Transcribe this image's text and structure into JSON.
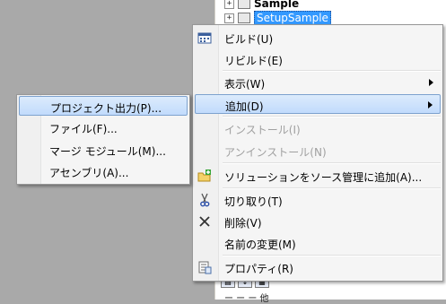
{
  "explorer": {
    "project_name": "Sample",
    "selected_project": "SetupSample",
    "bottom_label": "ー ー ー 他"
  },
  "context_menu": {
    "items": [
      {
        "label": "ビルド(U)",
        "icon": "build-icon"
      },
      {
        "label": "リビルド(E)"
      },
      {
        "label": "表示(W)"
      },
      {
        "label": "追加(D)"
      },
      {
        "label": "インストール(I)"
      },
      {
        "label": "アンインストール(N)"
      },
      {
        "label": "ソリューションをソース管理に追加(A)...",
        "icon": "add-to-source-control-icon"
      },
      {
        "label": "切り取り(T)",
        "icon": "scissors-icon"
      },
      {
        "label": "削除(V)",
        "icon": "delete-x-icon"
      },
      {
        "label": "名前の変更(M)"
      },
      {
        "label": "プロパティ(R)",
        "icon": "properties-icon"
      }
    ]
  },
  "add_submenu": {
    "items": [
      {
        "label": "プロジェクト出力(P)..."
      },
      {
        "label": "ファイル(F)..."
      },
      {
        "label": "マージ モジュール(M)..."
      },
      {
        "label": "アセンブリ(A)..."
      }
    ]
  },
  "colors": {
    "desktop": "#a9a9a9",
    "selection": "#3399ff",
    "menu_highlight_border": "#7da2ce",
    "disabled_text": "#a0a0a0"
  }
}
